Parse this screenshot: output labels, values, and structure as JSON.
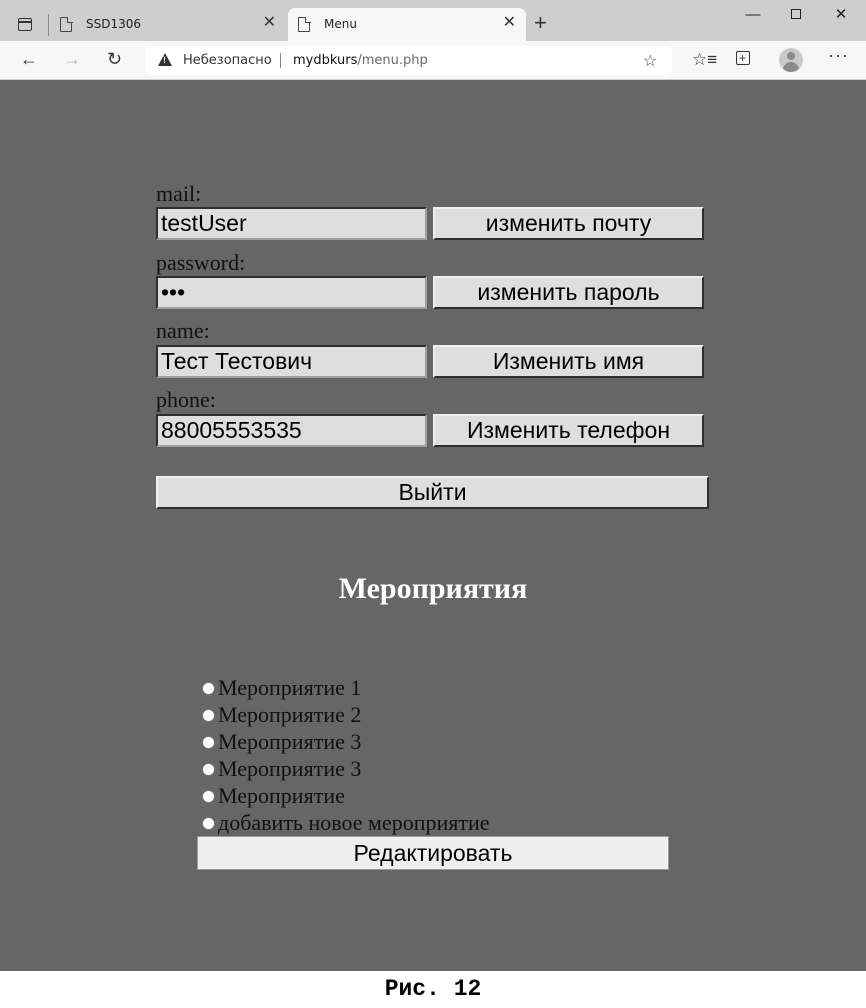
{
  "browser": {
    "tabs": [
      {
        "title": "SSD1306",
        "active": false
      },
      {
        "title": "Menu",
        "active": true
      }
    ],
    "address": {
      "security_label": "Небезопасно",
      "host": "mydbkurs",
      "path": "/menu.php"
    }
  },
  "form": {
    "mail": {
      "label": "mail:",
      "value": "testUser",
      "button": "изменить почту"
    },
    "password": {
      "label": "password:",
      "value": "•••",
      "button": "изменить пароль"
    },
    "name": {
      "label": "name:",
      "value": "Тест Тестович",
      "button": "Изменить имя"
    },
    "phone": {
      "label": "phone:",
      "value": "88005553535",
      "button": "Изменить телефон"
    },
    "logout_button": "Выйти"
  },
  "events": {
    "title": "Мероприятия",
    "options": [
      "Мероприятие 1",
      "Мероприятие 2",
      "Мероприятие 3",
      "Мероприятие 3",
      "Мероприятие",
      "добавить новое мероприятие"
    ],
    "edit_button": "Редактировать"
  },
  "caption": "Рис. 12"
}
